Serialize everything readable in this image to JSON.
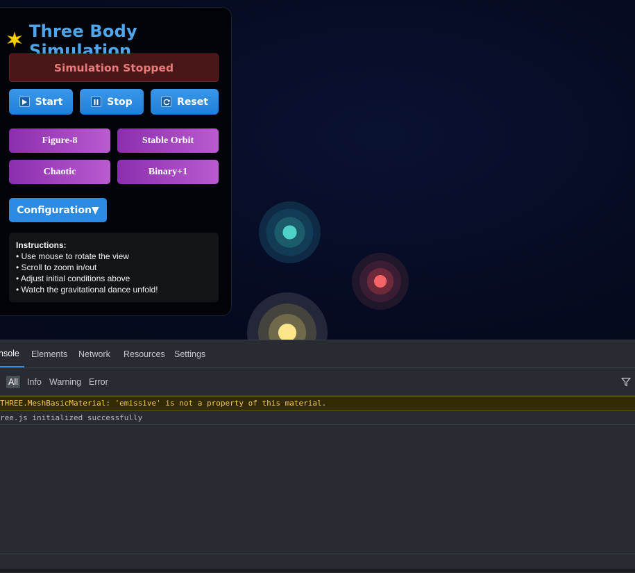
{
  "app": {
    "title": "Three Body Simulation",
    "title_icon": "star-icon",
    "status": "Simulation Stopped"
  },
  "controls": {
    "start_label": "Start",
    "stop_label": "Stop",
    "reset_label": "Reset"
  },
  "presets": {
    "figure8_label": "Figure-8",
    "stable_orbit_label": "Stable Orbit",
    "chaotic_label": "Chaotic",
    "binary_label": "Binary+1"
  },
  "config": {
    "label": "Configuration▼"
  },
  "instructions": {
    "heading": "Instructions:",
    "items": [
      "• Use mouse to rotate the view",
      "• Scroll to zoom in/out",
      "• Adjust initial conditions above",
      "• Watch the gravitational dance unfold!"
    ]
  },
  "devtools": {
    "tabs": [
      "nsole",
      "Elements",
      "Network",
      "Resources",
      "Settings"
    ],
    "filters": [
      "All",
      "Info",
      "Warning",
      "Error"
    ],
    "logs": {
      "warning": "THREE.MeshBasicMaterial: 'emissive' is not a property of this material.",
      "info": "ree.js initialized successfully"
    }
  },
  "colors": {
    "accent": "#4fa6ea",
    "status_bg": "#4a1719",
    "status_text": "#e97a7a",
    "purple": "#a445c1",
    "body_teal": "#4fd1c5",
    "body_red": "#f56565",
    "body_yellow": "#fde68a"
  }
}
